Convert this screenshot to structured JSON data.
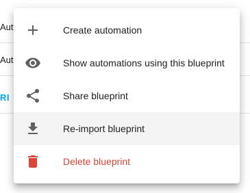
{
  "background": {
    "rows": [
      {
        "text": "Aut"
      },
      {
        "text": "Aut"
      }
    ],
    "link_text": "RI"
  },
  "menu": {
    "items": [
      {
        "label": "Create automation",
        "icon": "plus-icon"
      },
      {
        "label": "Show automations using this blueprint",
        "icon": "eye-icon"
      },
      {
        "label": "Share blueprint",
        "icon": "share-icon"
      },
      {
        "label": "Re-import blueprint",
        "icon": "download-icon",
        "highlighted": true
      },
      {
        "label": "Delete blueprint",
        "icon": "trash-icon",
        "danger": true
      }
    ]
  },
  "colors": {
    "icon": "#616161",
    "text": "#212121",
    "danger": "#db4437",
    "link": "#03a9f4",
    "hover": "#f4f4f4"
  }
}
